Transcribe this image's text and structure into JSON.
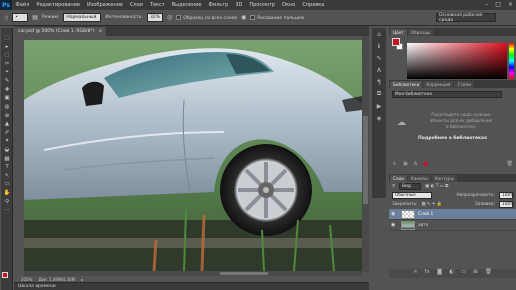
{
  "menu": {
    "logo": "Ps",
    "items": [
      "Файл",
      "Редактирование",
      "Изображение",
      "Слои",
      "Текст",
      "Выделение",
      "Фильтр",
      "3D",
      "Просмотр",
      "Окно",
      "Справка"
    ]
  },
  "options": {
    "mode_label": "Режим:",
    "mode_value": "Нормальный",
    "intensity_label": "Интенсивность:",
    "intensity_value": "32%",
    "all_layers_label": "Образец со всех слоев",
    "finger_label": "Рисование пальцем",
    "workspace": "Основная рабочая среда"
  },
  "document": {
    "tab_title": "car.psd @ 200% (Слой 1, RGB/8*)",
    "tab_close": "×",
    "zoom": "200%",
    "doc_size": "Док: 1,49M/4,50M"
  },
  "timeline": {
    "label": "Шкала времени"
  },
  "tools": [
    "⬚",
    "▸",
    "◌",
    "✂",
    "⌖",
    "✎",
    "✚",
    "▣",
    "◍",
    "⊕",
    "▲",
    "✐",
    "✦",
    "◒",
    "▦",
    "T",
    "↖",
    "▭",
    "✋",
    "⚲",
    "⋯"
  ],
  "colors": {
    "foreground": "#c4141c",
    "background": "#ffffff"
  },
  "panels": {
    "color_tabs": [
      "Цвет",
      "Образцы"
    ],
    "lib_tabs": [
      "Библиотеки",
      "Коррекция",
      "Стили"
    ],
    "lib_select": "Моя библиотека",
    "lib_empty_line1": "Перетащите сюда нужные",
    "lib_empty_line2": "объекты для их добавления",
    "lib_empty_line3": "в библиотеку",
    "lib_link": "Подробнее о библиотеках",
    "layer_tabs": [
      "Слои",
      "Каналы",
      "Контуры"
    ],
    "kind_label": "Вид",
    "blend_value": "Обычные",
    "opacity_label": "Непрозрачность:",
    "opacity_value": "100%",
    "lock_label": "Закрепить:",
    "fill_label": "Заливка:",
    "fill_value": "100%"
  },
  "layers": [
    {
      "name": "Слой 1",
      "active": true
    },
    {
      "name": "авто",
      "active": false
    }
  ]
}
